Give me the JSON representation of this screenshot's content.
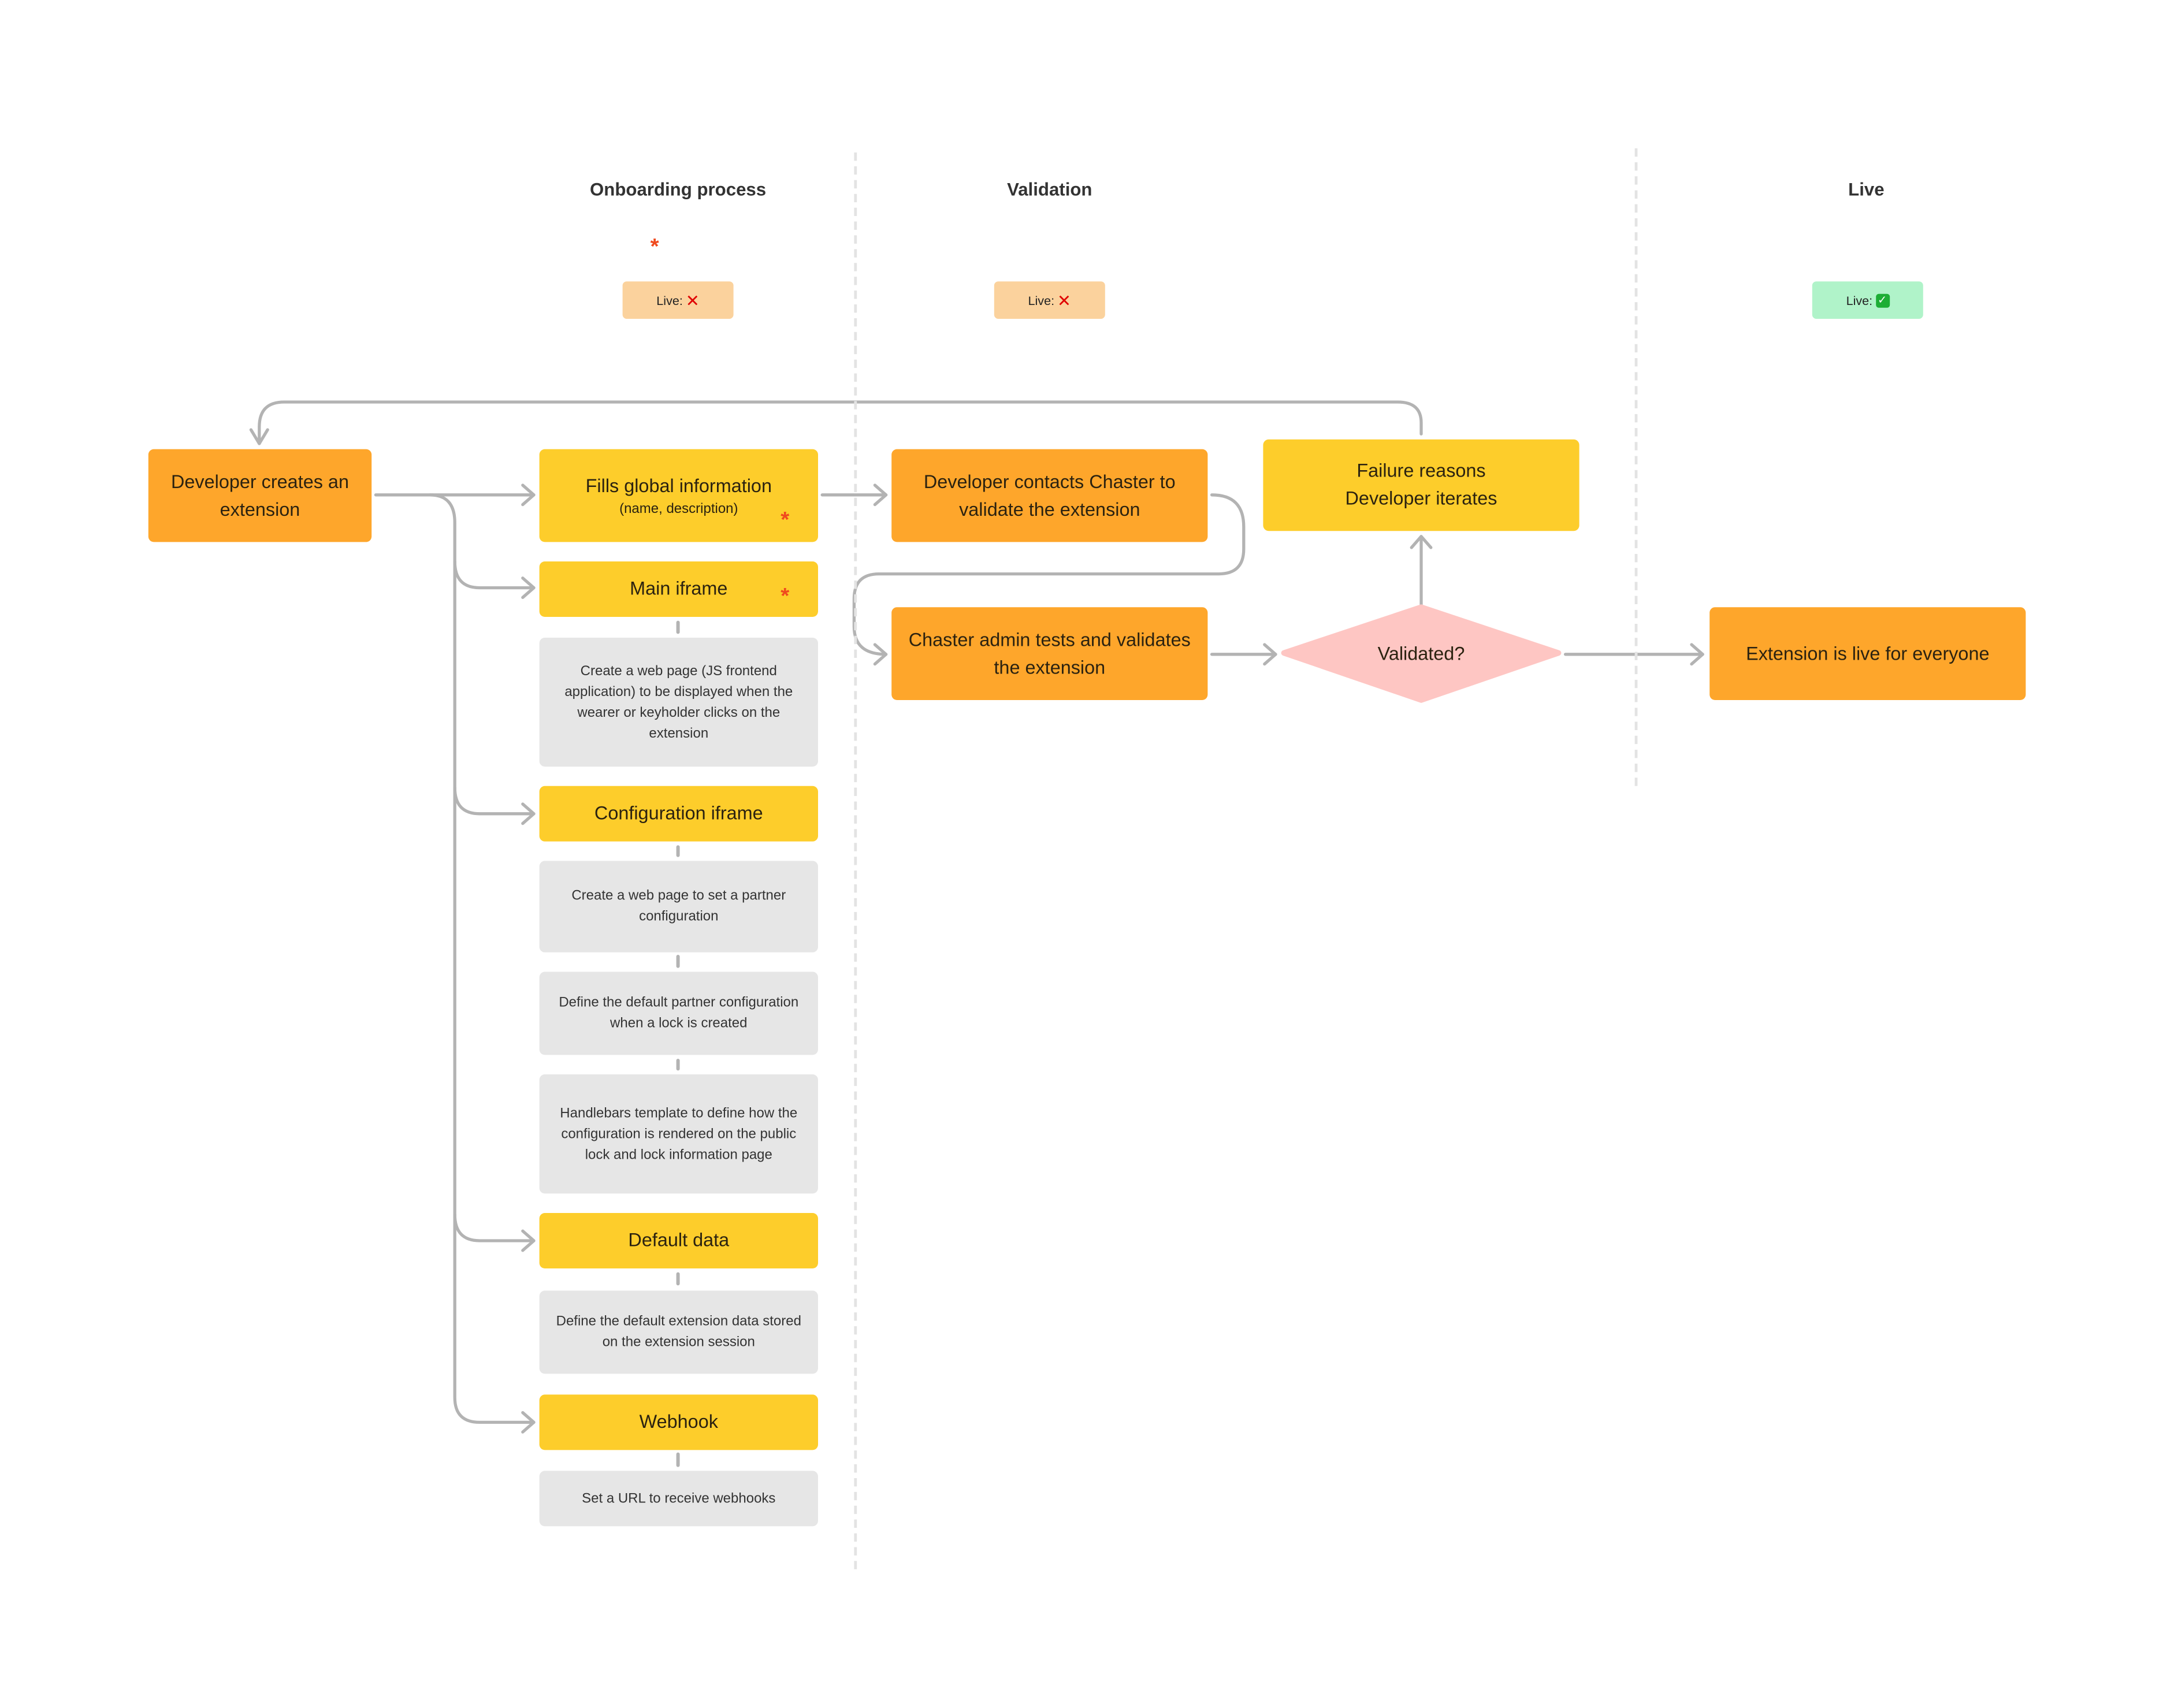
{
  "lanes": [
    {
      "title": "Onboarding process",
      "badge": {
        "label": "Live:",
        "status": "no",
        "icon": "cross-mark-icon",
        "color": "#fbd29d"
      }
    },
    {
      "title": "Validation",
      "badge": {
        "label": "Live:",
        "status": "no",
        "icon": "cross-mark-icon",
        "color": "#fbd29d"
      }
    },
    {
      "title": "Live",
      "badge": {
        "label": "Live:",
        "status": "yes",
        "icon": "check-mark-icon",
        "color": "#b0f3c9"
      }
    }
  ],
  "legend_required_marker": "*",
  "icons": {
    "cross": "✕",
    "check": "✓"
  },
  "nodes": {
    "developer_creates": "Developer creates an extension",
    "fills_global": {
      "title": "Fills global information",
      "subtitle": "(name, description)",
      "required": true
    },
    "main_iframe": {
      "title": "Main iframe",
      "required": true,
      "details": [
        "Create a web page (JS frontend application) to be displayed when the wearer or keyholder clicks on the extension"
      ]
    },
    "config_iframe": {
      "title": "Configuration iframe",
      "details": [
        "Create a web page to set a partner configuration",
        "Define the default partner configuration when a lock is created",
        "Handlebars template to define how the configuration is rendered on the public lock and lock information page"
      ]
    },
    "default_data": {
      "title": "Default data",
      "details": [
        "Define the default extension data stored on the extension session"
      ]
    },
    "webhook": {
      "title": "Webhook",
      "details": [
        "Set a URL to receive webhooks"
      ]
    },
    "developer_contacts": "Developer contacts Chaster to validate the extension",
    "admin_tests": "Chaster admin tests and validates the extension",
    "validated_decision": "Validated?",
    "failure": {
      "line1": "Failure reasons",
      "line2": "Developer iterates"
    },
    "live_everyone": "Extension is live for everyone"
  },
  "colors": {
    "step_orange": "#fea62b",
    "step_yellow": "#fdcd2b",
    "detail_gray": "#e6e6e6",
    "decision_pink": "#fec6c3",
    "connector_gray": "#b3b3b3",
    "required_red": "#f04a1e"
  }
}
